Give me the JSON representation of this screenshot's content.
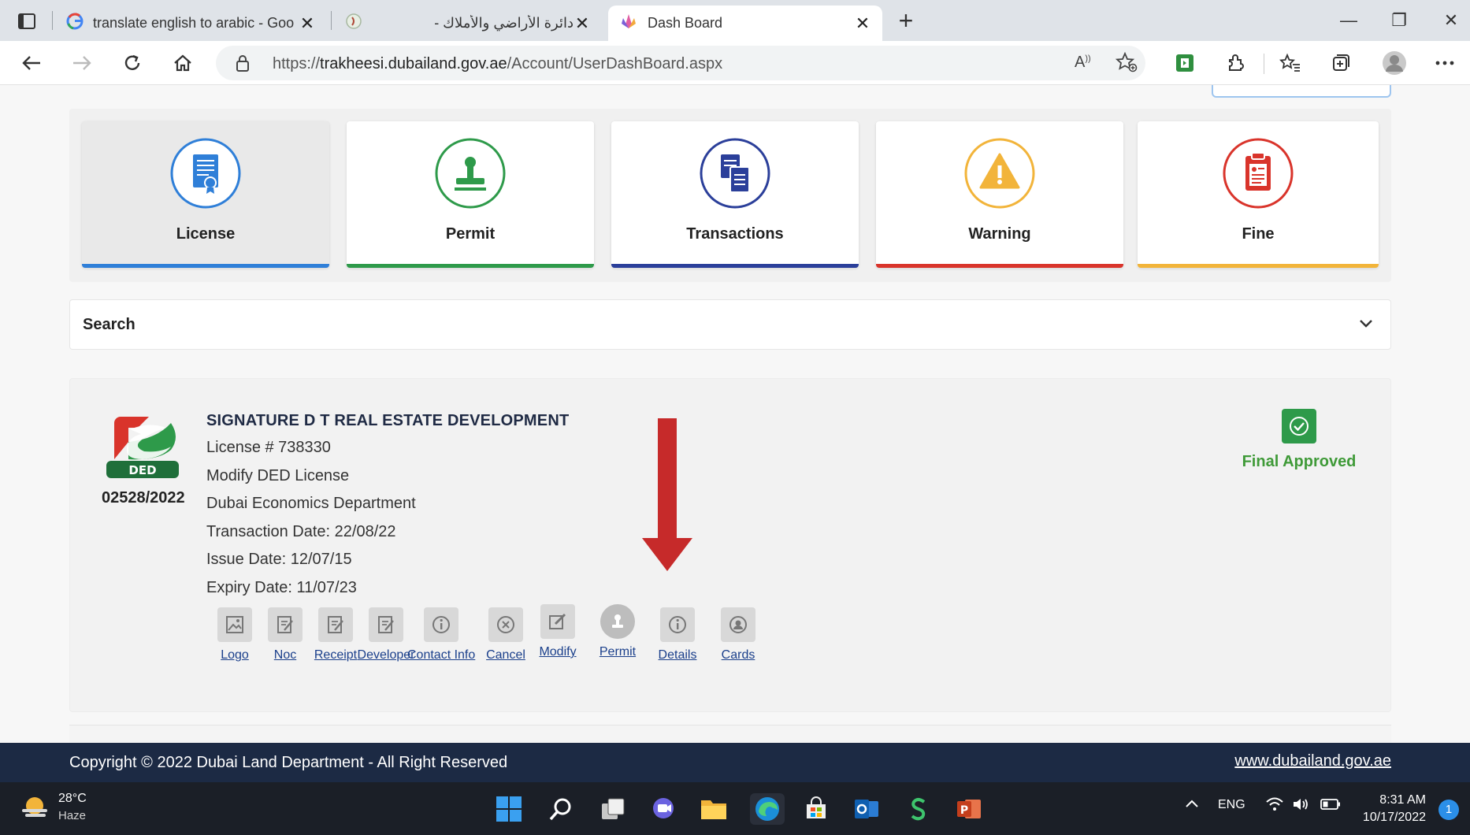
{
  "browser": {
    "tabs": [
      {
        "title": "translate english to arabic - Goo",
        "favicon": "google-icon"
      },
      {
        "title": "دائرة الأراضي والأملاك -",
        "favicon": "dld-icon"
      },
      {
        "title": "Dash Board",
        "favicon": "dashboard-icon"
      }
    ],
    "url_prefix": "https://",
    "url_host": "trakheesi.dubailand.gov.ae",
    "url_path": "/Account/UserDashBoard.aspx"
  },
  "categories": [
    {
      "label": "License",
      "accent": "#2f7fd8",
      "icon": "license-icon"
    },
    {
      "label": "Permit",
      "accent": "#2e9a4a",
      "icon": "permit-stamp-icon"
    },
    {
      "label": "Transactions",
      "accent": "#2b3f9a",
      "icon": "transactions-icon"
    },
    {
      "label": "Warning",
      "accent": "#d9342b",
      "icon": "warning-icon"
    },
    {
      "label": "Fine",
      "accent": "#f2b43a",
      "icon": "fine-clipboard-icon"
    }
  ],
  "search": {
    "label": "Search"
  },
  "record": {
    "ref": "02528/2022",
    "logo_text": "DED",
    "company": "SIGNATURE D T REAL ESTATE DEVELOPMENT",
    "license": "License # 738330",
    "type": "Modify DED License",
    "department": "Dubai Economics Department",
    "transaction_date": "Transaction Date: 22/08/22",
    "issue_date": "Issue Date: 12/07/15",
    "expiry_date": "Expiry Date: 11/07/23",
    "status": "Final Approved",
    "actions": [
      "Logo",
      "Noc",
      "Receipt",
      "Developer",
      "Contact Info",
      "Cancel",
      "Modify",
      "Permit",
      "Details",
      "Cards"
    ]
  },
  "footer": {
    "copyright": "Copyright © 2022 Dubai Land Department - All Right Reserved",
    "site": "www.dubailand.gov.ae"
  },
  "taskbar": {
    "temperature": "28°C",
    "condition": "Haze",
    "language": "ENG",
    "time": "8:31 AM",
    "date": "10/17/2022",
    "notifications": "1"
  }
}
